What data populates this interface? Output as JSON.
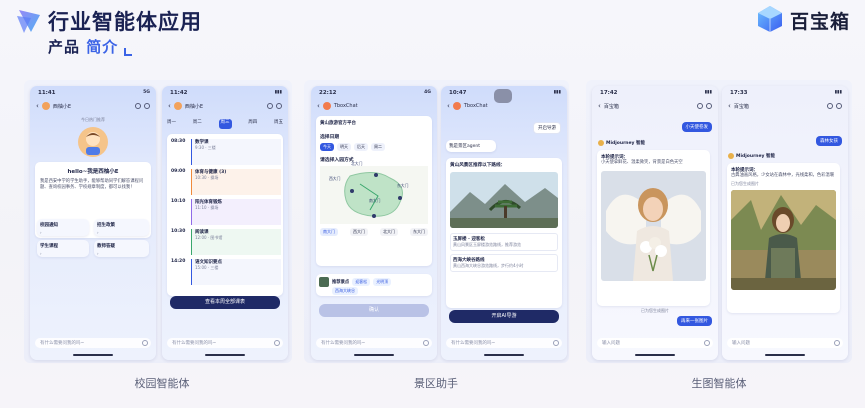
{
  "header": {
    "title": "行业智能体应用",
    "subtitle_part1": "产品",
    "subtitle_part2": "简介",
    "brand_name": "百宝箱"
  },
  "captions": [
    "校园智能体",
    "景区助手",
    "生图智能体"
  ],
  "phones": {
    "p1": {
      "time": "11:41",
      "signal": "5G",
      "nav_title": "西柚小E",
      "mini_label": "今日热门推荐",
      "greeting": "hello~我是西柚小E",
      "intro": "我是西安中学的学生助手，能够帮助同学们解答课程问题、查询校园事务、学校规章制度，都可以找我！",
      "tiles": [
        "校园通知",
        "招生政策",
        "学生课程",
        "教师答疑"
      ],
      "input_placeholder": "有什么需要问我的吗~"
    },
    "p2": {
      "time": "11:42",
      "nav_title": "西柚小E",
      "tabs": [
        "周一",
        "周二",
        "周三",
        "周四",
        "周五"
      ],
      "schedule": [
        {
          "time": "08:30",
          "title": "数学课",
          "meta": "9:30 · 三楼"
        },
        {
          "time": "09:00",
          "title": "体育与健康 (3)",
          "meta": "10:30 · 操场"
        },
        {
          "time": "10:10",
          "title": "阳光体育锻炼",
          "meta": "11:10 · 操场"
        },
        {
          "time": "10:30",
          "title": "阅读课",
          "meta": "12:00 · 图书馆"
        },
        {
          "time": "14:20",
          "title": "语文知识要点",
          "meta": "15:00 · 三楼"
        }
      ],
      "button": "查看本周全部课表",
      "input_placeholder": "有什么需要问我的吗~"
    },
    "p3": {
      "time": "22:12",
      "signal": "4G",
      "nav_title": "TboxChat",
      "plugin_title": "黄山旅游官方平台",
      "section_date": "选择日期",
      "dates": [
        "今天",
        "明天",
        "后天",
        "周二"
      ],
      "section_entry": "请选择入园方式",
      "map_labels": [
        "北大门",
        "西大门",
        "东大门",
        "南大门"
      ],
      "gates": [
        "南大门",
        "西大门",
        "北大门",
        "东大门"
      ],
      "card2_title": "推荐景点",
      "card2_tags": [
        "迎客松",
        "光明顶",
        "西海大峡谷"
      ],
      "button": "确认",
      "input_placeholder": "有什么需要问我的吗~"
    },
    "p4": {
      "time": "10:47",
      "nav_title": "TboxChat",
      "quick_action": "开启导游",
      "intro_bubble": "我是景区agent",
      "route_title": "黄山风景区推荐以下路线：",
      "route1_title": "玉屏楼 · 迎客松",
      "route1_desc": "黄山风景区玉屏楼游览路线，推荐游览",
      "route2_title": "西海大峡谷路线",
      "route2_desc": "黄山西海大峡谷游览路线，步行约4小时",
      "button": "开启AI导游",
      "input_placeholder": "有什么需要问我的吗~"
    },
    "p5": {
      "time": "17:42",
      "nav_title": "百宝箱",
      "user_bubble": "小天使卷发",
      "bot_name": "Midjourney 智能",
      "prompt_label": "本轮提示词：",
      "prompt_text": "小天使拿鲜花、温柔微笑，背景是白色天空",
      "done_text": "已为您生成图片",
      "suggestion": "再来一张图片",
      "input_placeholder": "输入问题"
    },
    "p6": {
      "time": "17:33",
      "nav_title": "百宝箱",
      "user_bubble": "森林女孩",
      "bot_name": "Midjourney 智能",
      "prompt_label": "本轮提示词：",
      "prompt_text": "古典油画风格，少女站在森林中，光线柔和，色彩温暖",
      "done_text": "已为您生成图片",
      "input_placeholder": "输入问题"
    }
  },
  "colors": {
    "title": "#1a2253",
    "accent": "#3b63e6",
    "button_dark": "#1f2a66"
  }
}
